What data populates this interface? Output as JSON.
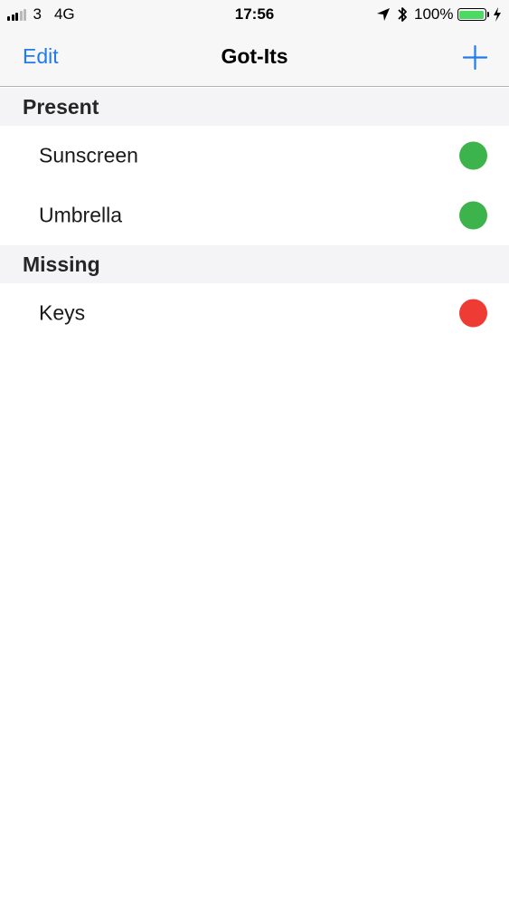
{
  "status_bar": {
    "signal_bars_active": 3,
    "carrier": "3",
    "network": "4G",
    "time": "17:56",
    "battery_percent": "100%",
    "battery_level": 1.0,
    "icons": [
      "location-arrow-icon",
      "bluetooth-icon",
      "battery-icon",
      "charging-bolt-icon"
    ]
  },
  "nav": {
    "edit_label": "Edit",
    "title": "Got-Its",
    "add_icon": "plus-icon"
  },
  "colors": {
    "accent": "#1e7cf0",
    "present": "#3cb44b",
    "missing": "#ee3b33",
    "battery": "#4cd964"
  },
  "sections": [
    {
      "title": "Present",
      "items": [
        {
          "label": "Sunscreen",
          "status": "present"
        },
        {
          "label": "Umbrella",
          "status": "present"
        }
      ]
    },
    {
      "title": "Missing",
      "items": [
        {
          "label": "Keys",
          "status": "missing"
        }
      ]
    }
  ]
}
